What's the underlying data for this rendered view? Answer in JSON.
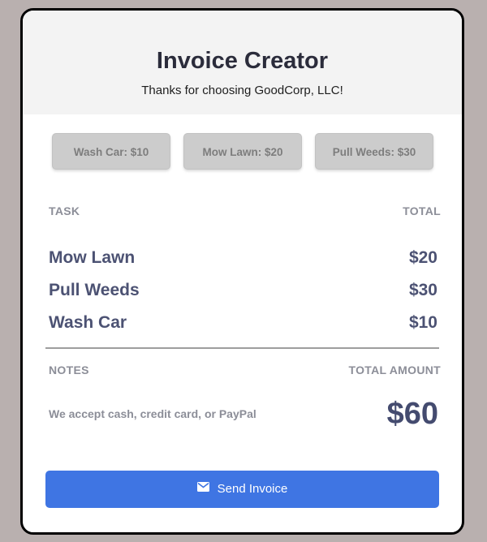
{
  "header": {
    "title": "Invoice Creator",
    "subtitle": "Thanks for choosing GoodCorp, LLC!"
  },
  "task_buttons": [
    {
      "label": "Wash Car: $10"
    },
    {
      "label": "Mow Lawn: $20"
    },
    {
      "label": "Pull Weeds: $30"
    }
  ],
  "table": {
    "task_header": "TASK",
    "total_header": "TOTAL",
    "rows": [
      {
        "task": "Mow Lawn",
        "price": "$20"
      },
      {
        "task": "Pull Weeds",
        "price": "$30"
      },
      {
        "task": "Wash Car",
        "price": "$10"
      }
    ]
  },
  "summary": {
    "notes_header": "NOTES",
    "total_amount_header": "TOTAL AMOUNT",
    "notes_text": "We accept cash, credit card, or PayPal",
    "total_amount": "$60"
  },
  "send_button": {
    "label": "Send Invoice",
    "icon": "envelope-icon"
  },
  "colors": {
    "accent": "#3f75e3",
    "background": "#b9b0af",
    "header_bg": "#f3f3f3",
    "text_dark": "#4c5273",
    "text_muted": "#8c8e98"
  }
}
